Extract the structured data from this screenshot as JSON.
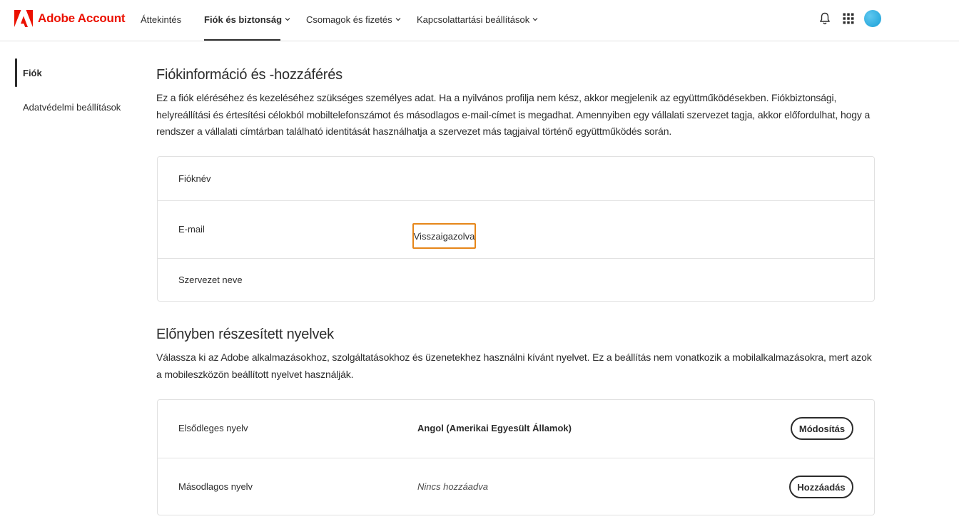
{
  "header": {
    "brand": "Adobe Account",
    "nav": [
      {
        "label": "Áttekintés"
      },
      {
        "label": "Fiók és biztonság"
      },
      {
        "label": "Csomagok és fizetés"
      },
      {
        "label": "Kapcsolattartási beállítások"
      }
    ],
    "icons": [
      "bell-icon",
      "apps-grid-icon",
      "avatar"
    ],
    "colors": {
      "brand_red": "#eb1000",
      "highlight": "#e68619"
    }
  },
  "sidebar": {
    "items": [
      {
        "label": "Fiók",
        "active": true
      },
      {
        "label": "Adatvédelmi beállítások",
        "active": false
      }
    ]
  },
  "account_section": {
    "title": "Fiókinformáció és -hozzáférés",
    "description": "Ez a fiók eléréséhez és kezeléséhez szükséges személyes adat. Ha a nyilvános profilja nem kész, akkor megjelenik az együttműködésekben. Fiókbiztonsági, helyreállítási és értesítési célokból mobiltelefonszámot és másodlagos e-mail-címet is megadhat. Amennyiben egy vállalati szervezet tagja, akkor előfordulhat, hogy a rendszer a vállalati címtárban található identitását használhatja a szervezet más tagjaival történő együttműködés során.",
    "rows": [
      {
        "label": "Fióknév"
      },
      {
        "label": "E-mail",
        "status": "Visszaigazolva"
      },
      {
        "label": "Szervezet neve"
      }
    ]
  },
  "language_section": {
    "title": "Előnyben részesített nyelvek",
    "description": "Válassza ki az Adobe alkalmazásokhoz, szolgáltatásokhoz és üzenetekhez használni kívánt nyelvet. Ez a beállítás nem vonatkozik a mobilalkalmazásokra, mert azok a mobileszközön beállított nyelvet használják.",
    "rows": [
      {
        "label": "Elsődleges nyelv",
        "value": "Angol (Amerikai Egyesült Államok)",
        "button": "Módosítás"
      },
      {
        "label": "Másodlagos nyelv",
        "value": "Nincs hozzáadva",
        "button": "Hozzáadás"
      }
    ]
  }
}
